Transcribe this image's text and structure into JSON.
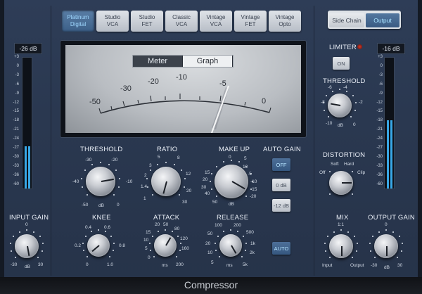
{
  "model_buttons": [
    {
      "label_line1": "Platinum",
      "label_line2": "Digital",
      "active": true
    },
    {
      "label_line1": "Studio",
      "label_line2": "VCA",
      "active": false
    },
    {
      "label_line1": "Studio",
      "label_line2": "FET",
      "active": false
    },
    {
      "label_line1": "Classic",
      "label_line2": "VCA",
      "active": false
    },
    {
      "label_line1": "Vintage",
      "label_line2": "VCA",
      "active": false
    },
    {
      "label_line1": "Vintage",
      "label_line2": "FET",
      "active": false
    },
    {
      "label_line1": "Vintage",
      "label_line2": "Opto",
      "active": false
    }
  ],
  "side_chain": {
    "label": "Side Chain"
  },
  "output_btn": {
    "label": "Output"
  },
  "input_meter": {
    "value": "-26 dB",
    "level": 0.32,
    "scale": [
      "+3",
      "0",
      "-3",
      "-6",
      "-9",
      "-12",
      "-15",
      "-18",
      "-21",
      "-24",
      "-27",
      "-30",
      "-33",
      "-36",
      "-60"
    ]
  },
  "output_meter": {
    "value": "-16 dB",
    "level": 0.52,
    "scale": [
      "+3",
      "0",
      "-3",
      "-6",
      "-9",
      "-12",
      "-15",
      "-18",
      "-21",
      "-24",
      "-27",
      "-30",
      "-33",
      "-36",
      "-60"
    ]
  },
  "display": {
    "tab_meter": "Meter",
    "tab_graph": "Graph",
    "scale": [
      "-50",
      "-30",
      "-20",
      "-10",
      "-5",
      "0"
    ]
  },
  "threshold": {
    "title": "THRESHOLD",
    "scale": [
      "-30",
      "-20",
      "-40",
      "-10",
      "-50",
      "0"
    ],
    "unit": "dB"
  },
  "ratio": {
    "title": "RATIO",
    "scale": [
      "3",
      "5",
      "8",
      "2",
      "12",
      "1.4",
      "20",
      "1",
      "30"
    ]
  },
  "makeup": {
    "title": "MAKE UP",
    "scale": [
      "0",
      "5",
      "10",
      "15",
      "-5",
      "20",
      "-10",
      "30",
      "-15",
      "40",
      "-20",
      "50"
    ],
    "unit": "dB"
  },
  "auto_gain": {
    "title": "AUTO GAIN",
    "off": "OFF",
    "zero": "0 dB",
    "minus12": "-12 dB"
  },
  "knee": {
    "title": "KNEE",
    "scale": [
      "0.4",
      "0.6",
      "0.2",
      "0.8",
      "0",
      "1.0"
    ]
  },
  "attack": {
    "title": "ATTACK",
    "scale": [
      "20",
      "50",
      "15",
      "80",
      "10",
      "120",
      "5",
      "160",
      "0",
      "200"
    ],
    "unit": "ms"
  },
  "release": {
    "title": "RELEASE",
    "scale": [
      "100",
      "200",
      "50",
      "500",
      "20",
      "1k",
      "10",
      "2k",
      "5",
      "5k"
    ],
    "unit": "ms"
  },
  "auto_release": {
    "label": "AUTO"
  },
  "input_gain": {
    "title": "INPUT GAIN",
    "scale": [
      "0",
      "-30",
      "30"
    ],
    "unit": "dB"
  },
  "limiter": {
    "title": "LIMITER",
    "on": "ON"
  },
  "limiter_threshold": {
    "title": "THRESHOLD",
    "scale": [
      "-6",
      "-4",
      "-8",
      "-2",
      "-10",
      "0"
    ],
    "unit": "dB"
  },
  "distortion": {
    "title": "DISTORTION",
    "soft": "Soft",
    "hard": "Hard",
    "off": "Off",
    "clip": "Clip"
  },
  "mix": {
    "title": "MIX",
    "top": "1:1",
    "input": "Input",
    "output": "Output"
  },
  "output_gain": {
    "title": "OUTPUT GAIN",
    "scale": [
      "0",
      "-30",
      "30"
    ],
    "unit": "dB"
  },
  "footer": {
    "title": "Compressor"
  }
}
